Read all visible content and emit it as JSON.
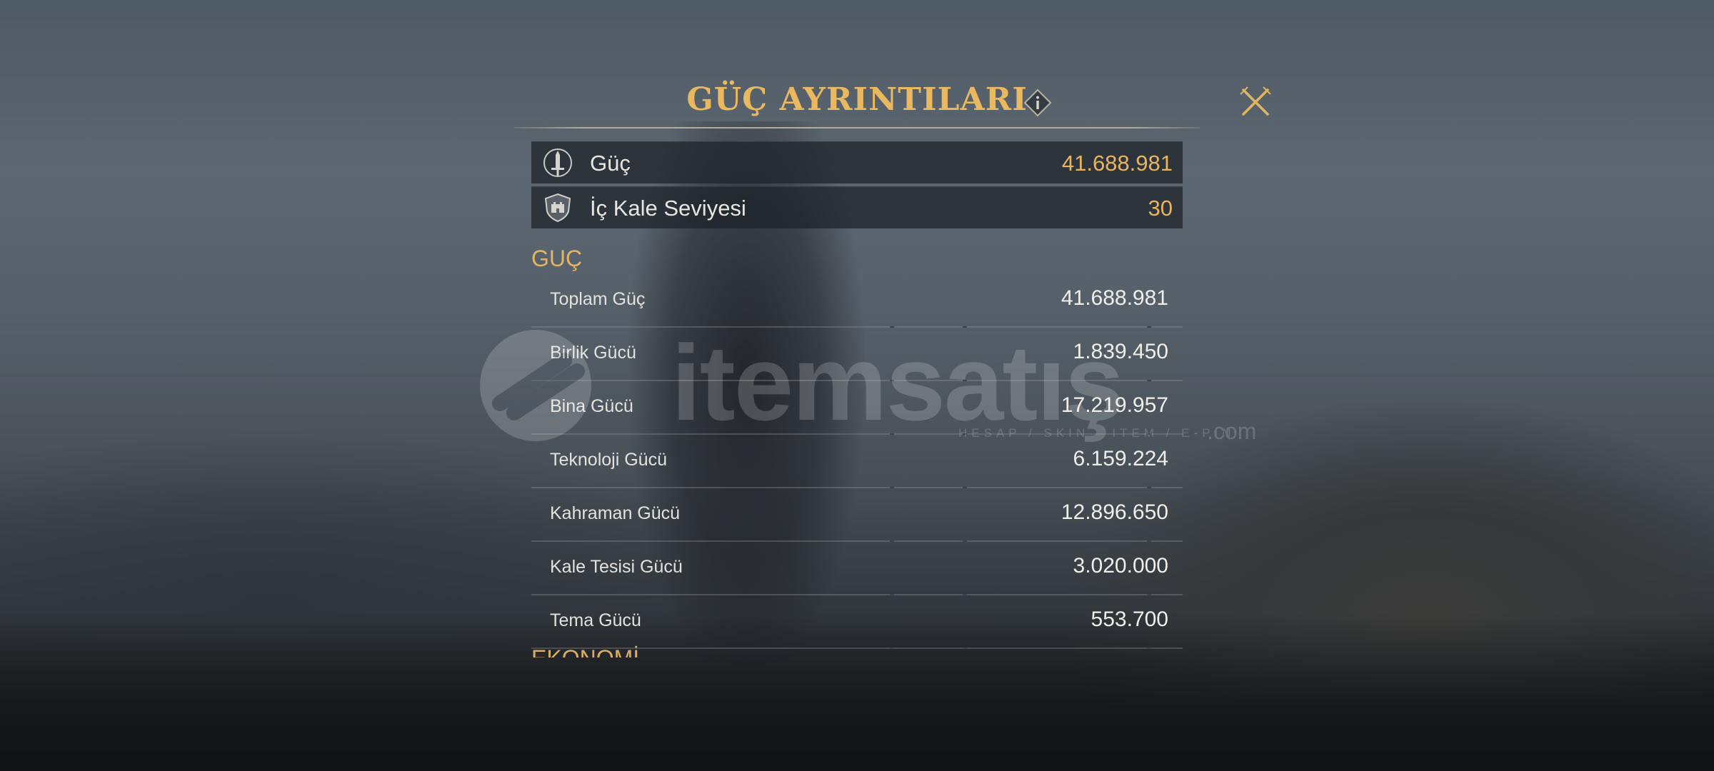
{
  "header": {
    "title": "GÜÇ AYRINTILARI",
    "info_icon": "info-icon",
    "close_icon": "close-icon"
  },
  "summary": [
    {
      "icon": "power-sword-icon",
      "label": "Güç",
      "value": "41.688.981"
    },
    {
      "icon": "castle-shield-icon",
      "label": "İç Kale Seviyesi",
      "value": "30"
    }
  ],
  "power_section": {
    "title": "GUÇ",
    "rows": [
      {
        "label": "Toplam Güç",
        "value": "41.688.981"
      },
      {
        "label": "Birlik Gücü",
        "value": "1.839.450"
      },
      {
        "label": "Bina Gücü",
        "value": "17.219.957"
      },
      {
        "label": "Teknoloji Gücü",
        "value": "6.159.224"
      },
      {
        "label": "Kahraman Gücü",
        "value": "12.896.650"
      },
      {
        "label": "Kale Tesisi Gücü",
        "value": "3.020.000"
      },
      {
        "label": "Tema Gücü",
        "value": "553.700"
      }
    ]
  },
  "next_section_title": "EKONOMİ",
  "watermark": {
    "text": "itemsatış",
    "sub": "HESAP / SKIN / ITEM / E-PIN",
    "domain": ".com"
  },
  "colors": {
    "accent_gold": "#e9b85f",
    "value_gold": "#e8b45c",
    "text_light": "#e8e6e1"
  }
}
